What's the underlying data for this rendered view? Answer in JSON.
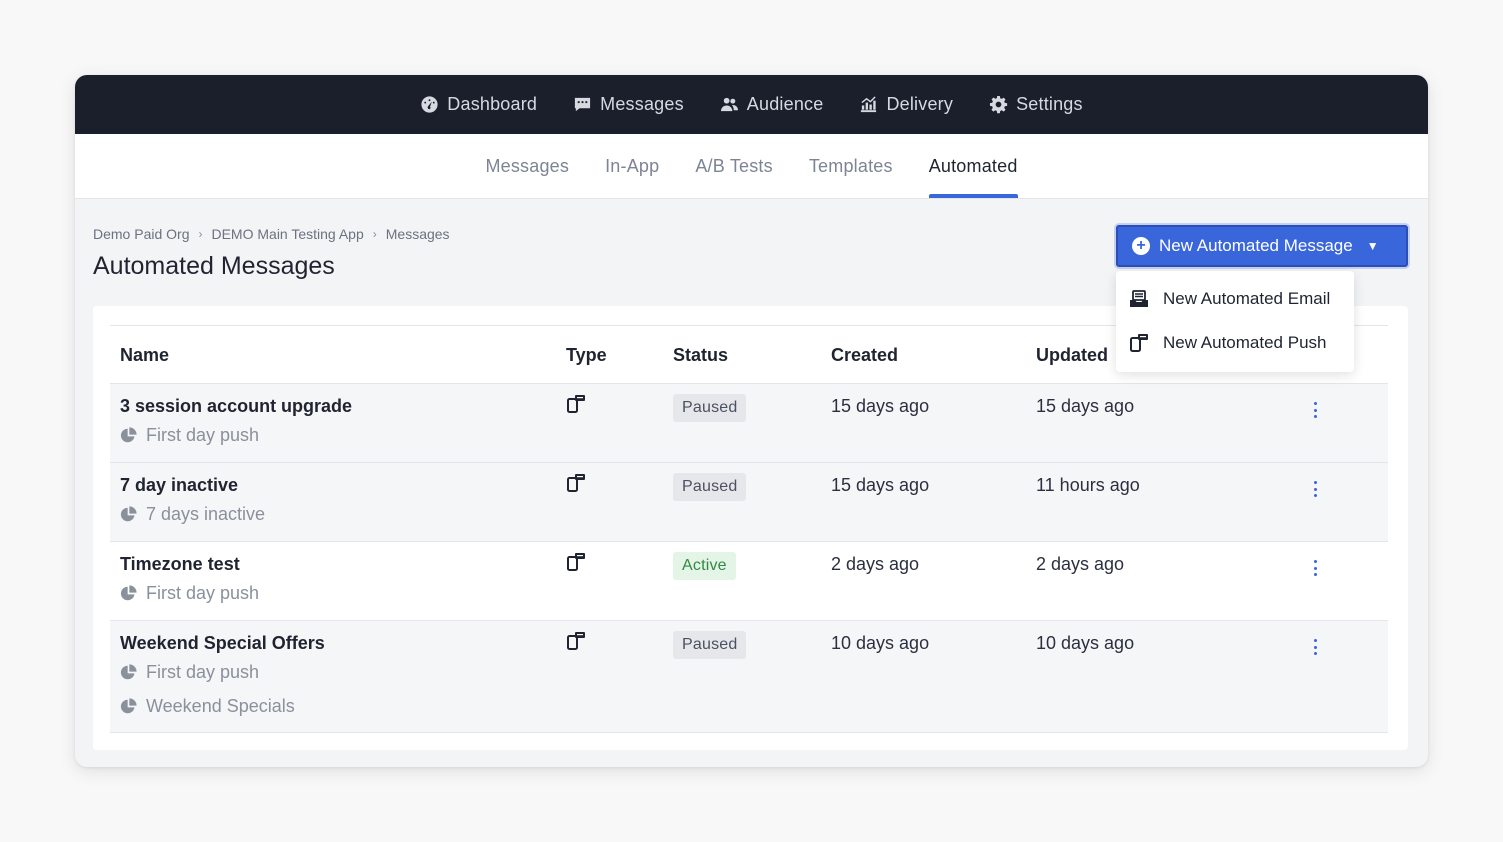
{
  "topnav": {
    "items": [
      {
        "label": "Dashboard",
        "icon": "dashboard-gauge-icon"
      },
      {
        "label": "Messages",
        "icon": "message-bubble-icon"
      },
      {
        "label": "Audience",
        "icon": "users-icon"
      },
      {
        "label": "Delivery",
        "icon": "chart-icon"
      },
      {
        "label": "Settings",
        "icon": "gear-icon"
      }
    ]
  },
  "subnav": {
    "items": [
      {
        "label": "Messages",
        "active": false
      },
      {
        "label": "In-App",
        "active": false
      },
      {
        "label": "A/B Tests",
        "active": false
      },
      {
        "label": "Templates",
        "active": false
      },
      {
        "label": "Automated",
        "active": true
      }
    ]
  },
  "breadcrumb": [
    "Demo Paid Org",
    "DEMO Main Testing App",
    "Messages"
  ],
  "page_title": "Automated Messages",
  "new_button": {
    "label": "New Automated Message",
    "icon": "plus-circle-icon",
    "caret": "▼"
  },
  "dropdown": {
    "items": [
      {
        "label": "New Automated Email",
        "icon": "email-tray-icon"
      },
      {
        "label": "New Automated Push",
        "icon": "push-device-icon"
      }
    ]
  },
  "table": {
    "headers": {
      "name": "Name",
      "type": "Type",
      "status": "Status",
      "created": "Created",
      "updated": "Updated"
    },
    "rows": [
      {
        "name": "3 session account upgrade",
        "segments": [
          "First day push"
        ],
        "type": "push",
        "status": "Paused",
        "created": "15 days ago",
        "updated": "15 days ago"
      },
      {
        "name": "7 day inactive",
        "segments": [
          "7 days inactive"
        ],
        "type": "push",
        "status": "Paused",
        "created": "15 days ago",
        "updated": "11 hours ago"
      },
      {
        "name": "Timezone test",
        "segments": [
          "First day push"
        ],
        "type": "push",
        "status": "Active",
        "created": "2 days ago",
        "updated": "2 days ago"
      },
      {
        "name": "Weekend Special Offers",
        "segments": [
          "First day push",
          "Weekend Specials"
        ],
        "type": "push",
        "status": "Paused",
        "created": "10 days ago",
        "updated": "10 days ago"
      }
    ]
  },
  "colors": {
    "accent": "#3a66db",
    "nav_bg": "#1b1f2c",
    "active_badge_text": "#2f8a44"
  }
}
